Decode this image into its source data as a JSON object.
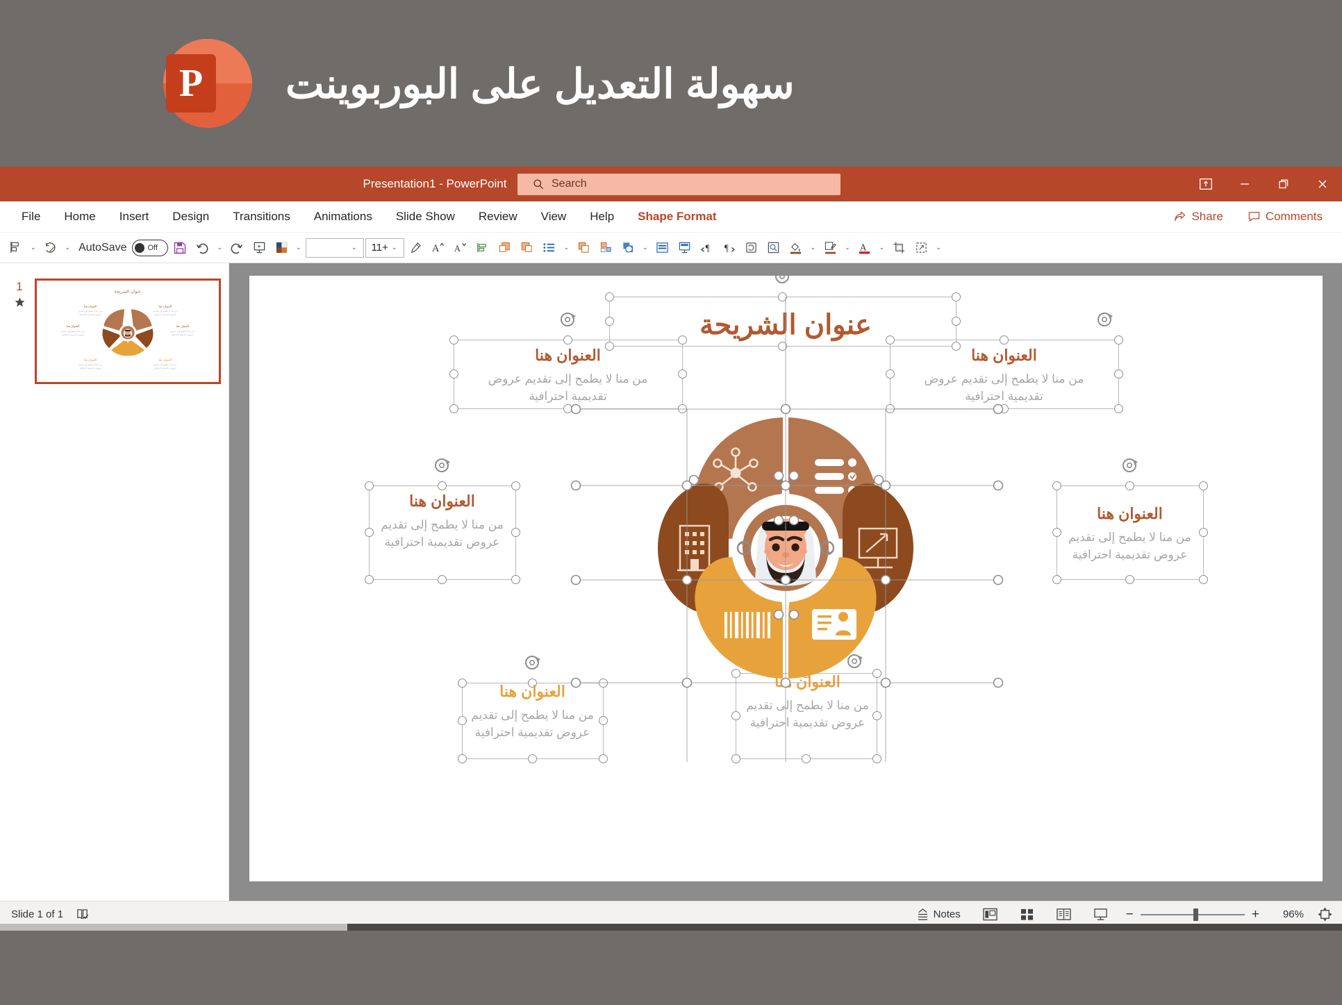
{
  "promo": {
    "logo_letter": "P",
    "headline": "سهولة التعديل على البوربوينت"
  },
  "titlebar": {
    "title": "Presentation1  -  PowerPoint",
    "search_placeholder": "Search",
    "ribbon_display_icon": "ribbon-display-options-icon",
    "minimize_icon": "minimize-icon",
    "restore_icon": "restore-icon",
    "close_icon": "close-icon"
  },
  "menubar": {
    "items": [
      {
        "label": "File",
        "accent": false
      },
      {
        "label": "Home",
        "accent": false
      },
      {
        "label": "Insert",
        "accent": false
      },
      {
        "label": "Design",
        "accent": false
      },
      {
        "label": "Transitions",
        "accent": false
      },
      {
        "label": "Animations",
        "accent": false
      },
      {
        "label": "Slide Show",
        "accent": false
      },
      {
        "label": "Review",
        "accent": false
      },
      {
        "label": "View",
        "accent": false
      },
      {
        "label": "Help",
        "accent": false
      },
      {
        "label": "Shape Format",
        "accent": true
      }
    ],
    "share_label": "Share",
    "comments_label": "Comments"
  },
  "toolbar": {
    "autosave_label": "AutoSave",
    "autosave_state": "Off",
    "font_name": "",
    "font_size": "11+",
    "icons": [
      "align-objects-icon",
      "rotate-objects-icon",
      "save-icon",
      "undo-icon",
      "redo-icon",
      "start-slideshow-icon",
      "shape-fill-icon",
      "format-painter-icon",
      "increase-font-size-icon",
      "decrease-font-size-icon",
      "align-text-icon",
      "bring-forward-icon",
      "send-backward-icon",
      "bullets-icon",
      "group-objects-icon",
      "arrange-objects-icon",
      "shape-outline-icon",
      "text-box-icon",
      "insert-placeholder-icon",
      "rtl-text-direction-icon",
      "ltr-text-direction-icon",
      "reset-slide-icon",
      "selection-pane-icon",
      "fill-color-icon",
      "line-color-icon",
      "font-color-icon",
      "crop-icon",
      "size-icon",
      "overflow-icon"
    ]
  },
  "thumbnails": {
    "slides": [
      {
        "number": "1",
        "starred": true
      }
    ]
  },
  "slide": {
    "title": "عنوان الشريحة",
    "callouts": [
      {
        "id": "top-left",
        "heading": "العنوان هنا",
        "body": "من منا لا يطمح إلى تقديم عروض تقديمية احترافية",
        "color": "#b05a30"
      },
      {
        "id": "top-right",
        "heading": "العنوان هنا",
        "body": "من منا لا يطمح إلى تقديم عروض تقديمية احترافية",
        "color": "#b05a30"
      },
      {
        "id": "mid-left",
        "heading": "العنوان هنا",
        "body": "من منا لا يطمح إلى تقديم عروض تقديمية احترافية",
        "color": "#b05a30"
      },
      {
        "id": "mid-right",
        "heading": "العنوان هنا",
        "body": "من منا لا يطمح إلى تقديم عروض تقديمية احترافية",
        "color": "#b05a30"
      },
      {
        "id": "bottom-left",
        "heading": "العنوان هنا",
        "body": "من منا لا يطمح إلى تقديم عروض تقديمية احترافية",
        "color": "#e8a23c"
      },
      {
        "id": "bottom-right",
        "heading": "العنوان هنا",
        "body": "من منا لا يطمح إلى تقديم عروض تقديمية احترافية",
        "color": "#e8a23c"
      }
    ],
    "infographic": {
      "center_icon": "arab-man-avatar-icon",
      "petals": [
        {
          "position": "top-left",
          "color": "#b4764f",
          "icon": "network-nodes-icon"
        },
        {
          "position": "top-right",
          "color": "#b4764f",
          "icon": "list-bullets-icon"
        },
        {
          "position": "mid-left",
          "color": "#8c4a1e",
          "icon": "office-building-icon"
        },
        {
          "position": "mid-right",
          "color": "#8c4a1e",
          "icon": "presentation-chart-icon"
        },
        {
          "position": "bottom-left",
          "color": "#e8a23c",
          "icon": "barcode-icon"
        },
        {
          "position": "bottom-right",
          "color": "#e8a23c",
          "icon": "id-card-icon"
        }
      ]
    }
  },
  "statusbar": {
    "slide_counter": "Slide 1 of 1",
    "accessibility_icon": "accessibility-check-icon",
    "notes_label": "Notes",
    "normal_view_icon": "normal-view-icon",
    "sorter_view_icon": "slide-sorter-view-icon",
    "reading_view_icon": "reading-view-icon",
    "slideshow_view_icon": "slideshow-view-icon",
    "zoom_out_label": "−",
    "zoom_in_label": "+",
    "zoom_percent": "96%",
    "fit_slide_icon": "fit-slide-to-window-icon"
  },
  "colors": {
    "brand": "#b7472a",
    "accent_brown": "#b05a30",
    "accent_amber": "#e8a23c",
    "dark_brown": "#8c4a1e",
    "light_brown": "#b4764f"
  }
}
